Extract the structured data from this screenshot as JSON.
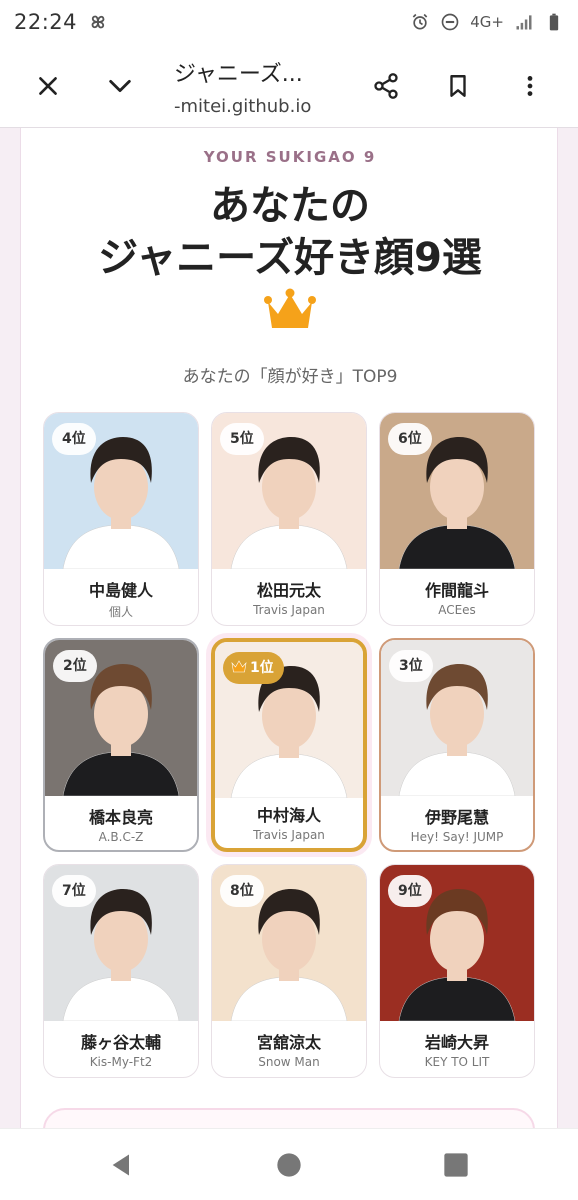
{
  "status": {
    "time": "22:24",
    "network": "4G+"
  },
  "browser": {
    "title": "ジャニーズ...",
    "url": "-mitei.github.io"
  },
  "page": {
    "kicker": "YOUR SUKIGAO 9",
    "headline_line1": "あなたの",
    "headline_line2": "ジャニーズ好き顔9選",
    "subtitle": "あなたの「顔が好き」TOP9"
  },
  "cards": [
    {
      "rank": "4位",
      "name": "中島健人",
      "group": "個人",
      "tier": "normal",
      "bg": "#cfe2f1"
    },
    {
      "rank": "5位",
      "name": "松田元太",
      "group": "Travis Japan",
      "tier": "normal",
      "bg": "#f7e6dc"
    },
    {
      "rank": "6位",
      "name": "作間龍斗",
      "group": "ACEes",
      "tier": "normal",
      "bg": "#c9a98a"
    },
    {
      "rank": "2位",
      "name": "橋本良亮",
      "group": "A.B.C-Z",
      "tier": "silver",
      "bg": "#7a7470"
    },
    {
      "rank": "1位",
      "name": "中村海人",
      "group": "Travis Japan",
      "tier": "gold",
      "bg": "#f6ece4"
    },
    {
      "rank": "3位",
      "name": "伊野尾慧",
      "group": "Hey! Say! JUMP",
      "tier": "bronze",
      "bg": "#e9e7e6"
    },
    {
      "rank": "7位",
      "name": "藤ヶ谷太輔",
      "group": "Kis-My-Ft2",
      "tier": "normal",
      "bg": "#dfe1e3"
    },
    {
      "rank": "8位",
      "name": "宮舘涼太",
      "group": "Snow Man",
      "tier": "normal",
      "bg": "#f3e1cc"
    },
    {
      "rank": "9位",
      "name": "岩崎大昇",
      "group": "KEY TO LIT",
      "tier": "normal",
      "bg": "#9b2e22"
    }
  ],
  "colors": {
    "gold": "#d9a336",
    "crown": "#f5a21a",
    "kicker": "#9a7088"
  },
  "icons": [
    "close-icon",
    "chevron-down-icon",
    "share-icon",
    "bookmark-icon",
    "more-icon",
    "back-icon",
    "home-icon",
    "recents-icon"
  ]
}
